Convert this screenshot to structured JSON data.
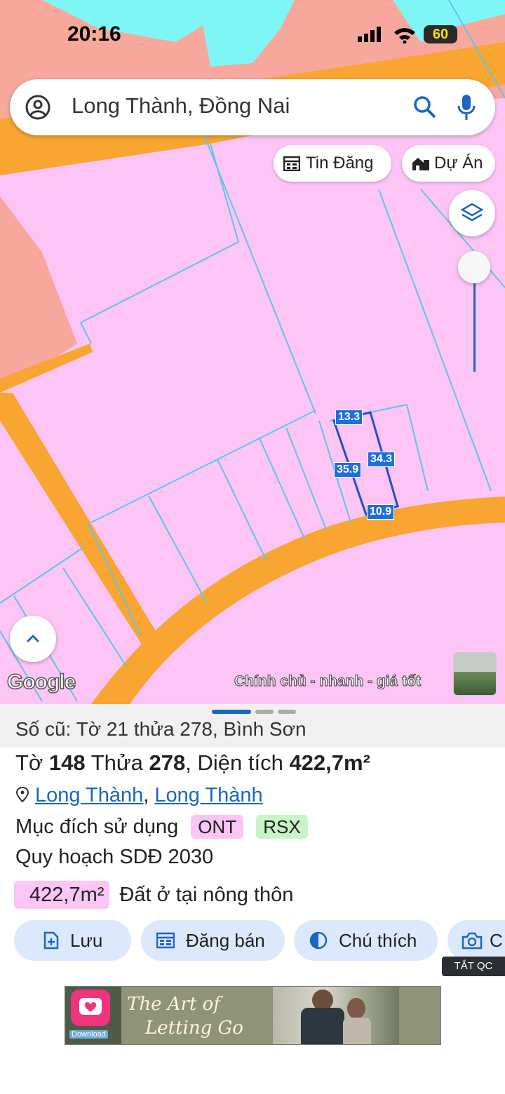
{
  "status": {
    "time": "20:16",
    "battery": "60"
  },
  "search": {
    "text": "Long Thành, Đồng Nai"
  },
  "chips": {
    "listings": "Tin Đăng",
    "projects": "Dự Án"
  },
  "map": {
    "dimensions": {
      "top": "13.3",
      "right": "34.3",
      "left": "35.9",
      "bottom": "10.9"
    },
    "attribution": "Google",
    "promo": "Chính chủ - nhanh - giá tốt"
  },
  "parcel": {
    "old_ref": "Số cũ: Tờ 21 thửa 278, Bình Sơn",
    "sheet_label": "Tờ",
    "sheet_no": "148",
    "plot_label": "Thửa",
    "plot_no": "278",
    "comma": ",",
    "area_label": "Diện tích",
    "area": "422,7m²",
    "location_a": "Long Thành",
    "location_b": "Long Thành",
    "purpose_label": "Mục đích sử dụng",
    "purpose_tags": [
      "ONT",
      "RSX"
    ],
    "plan_label": "Quy hoạch SDĐ 2030",
    "usage_area": "422,7m²",
    "usage_desc": "Đất ở tại nông thôn"
  },
  "actions": {
    "save": "Lưu",
    "post": "Đăng bán",
    "legend": "Chú thích",
    "photo": "C"
  },
  "ad": {
    "toggle": "TẮT QC",
    "title_a": "The Art of",
    "title_b": "Letting Go",
    "download": "Download"
  },
  "colors": {
    "accent": "#1a66c2",
    "road": "#f9a531",
    "parcel": "#fcc5f5",
    "water": "#7ff6f6"
  }
}
